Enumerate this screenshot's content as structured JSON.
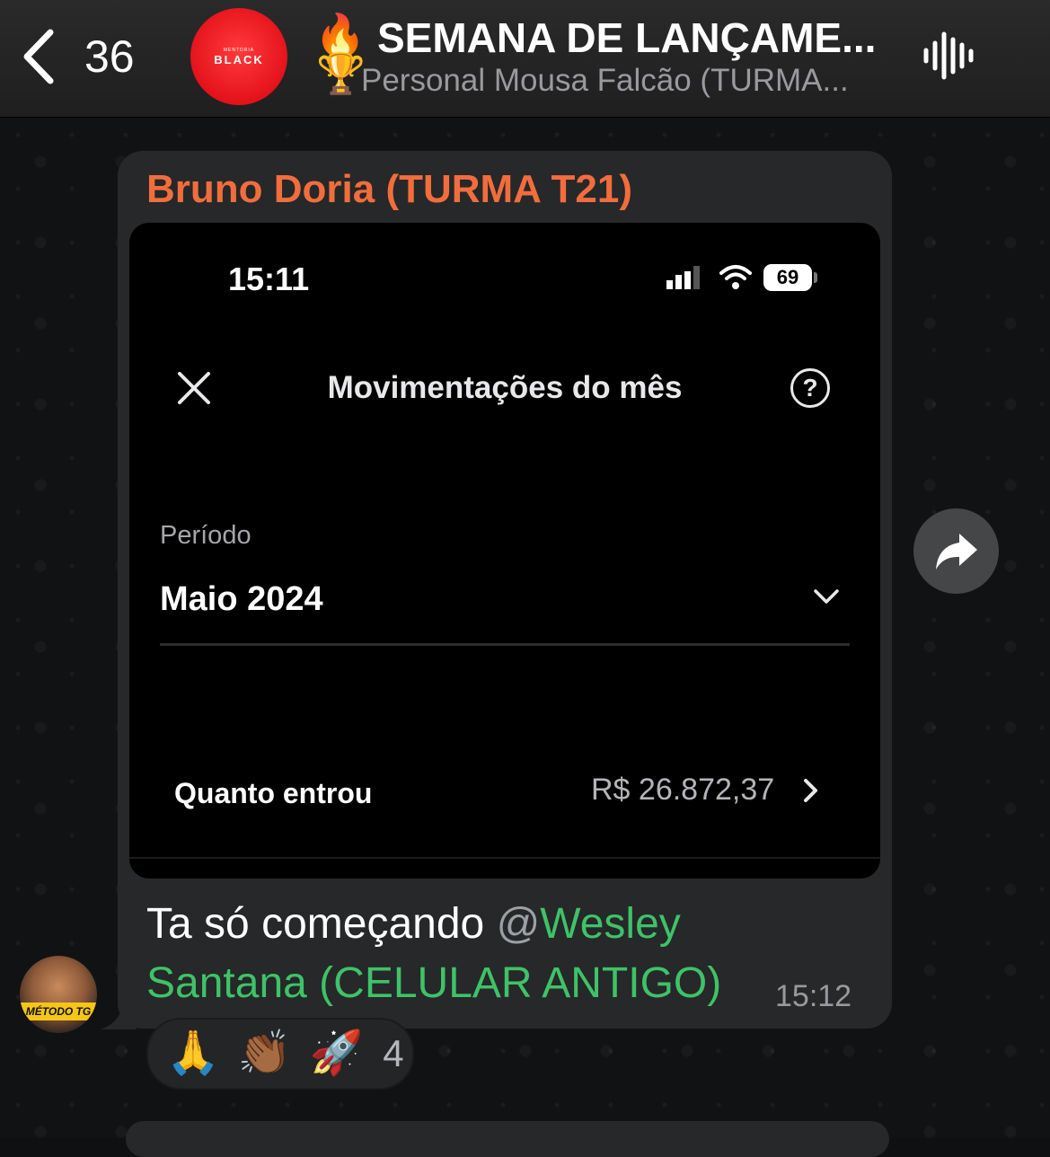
{
  "header": {
    "back_count": "36",
    "group_avatar_logo": "BLACK",
    "group_avatar_logo_top": "MENTORIA",
    "title_emoji_top": "🔥",
    "title_emoji_bottom": "🏆",
    "title": "SEMANA DE LANÇAME...",
    "subtitle": "Personal Mousa Falcão (TURMA..."
  },
  "message": {
    "sender": "Bruno Doria (TURMA T21)",
    "text_prefix": "Ta só começando ",
    "mention_at": "@",
    "mention_name": "Wesley Santana (CELULAR ANTIGO)",
    "time": "15:12",
    "sender_avatar_label": "MÉTODO TG"
  },
  "screenshot": {
    "status_time": "15:11",
    "battery": "69",
    "heading": "Movimentações do mês",
    "help_symbol": "?",
    "period_label": "Período",
    "period_value": "Maio 2024",
    "income_label": "Quanto entrou",
    "income_value": "R$ 26.872,37"
  },
  "reactions": {
    "emojis": [
      "🙏",
      "👏🏾",
      "🚀"
    ],
    "count": "4"
  },
  "colors": {
    "sender_name": "#f26d3c",
    "mention": "#3fc268",
    "bubble": "#262829",
    "group_avatar": "#e4121a"
  }
}
